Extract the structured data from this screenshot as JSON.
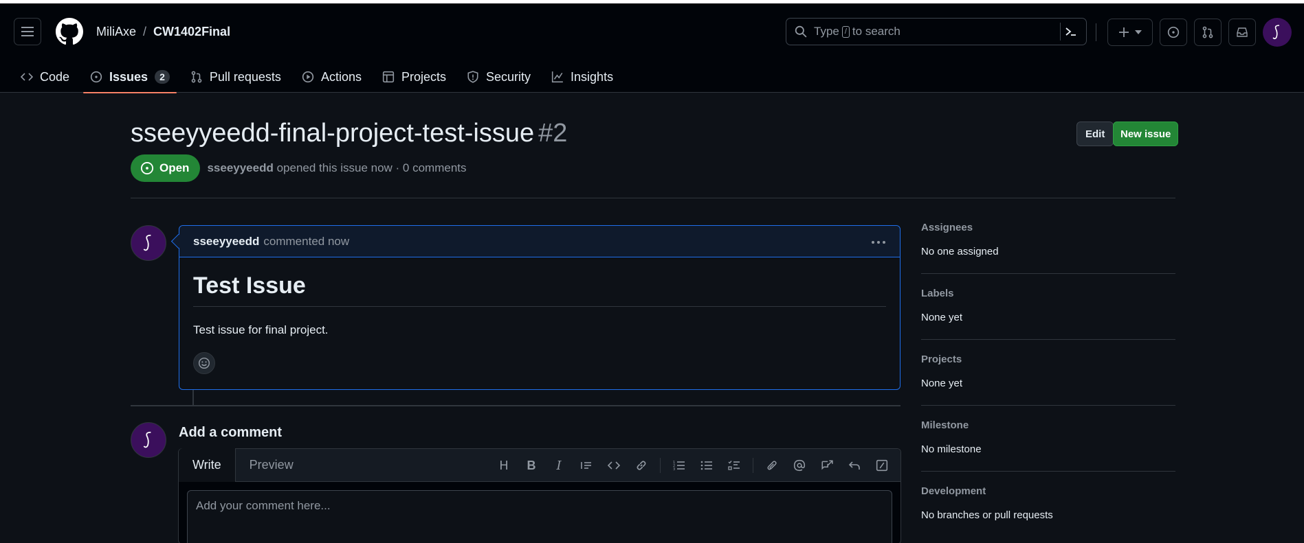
{
  "header": {
    "owner": "MiliAxe",
    "separator": "/",
    "repo": "CW1402Final",
    "search_prefix": "Type",
    "search_key": "/",
    "search_suffix": "to search"
  },
  "tabs": [
    {
      "label": "Code"
    },
    {
      "label": "Issues",
      "count": "2"
    },
    {
      "label": "Pull requests"
    },
    {
      "label": "Actions"
    },
    {
      "label": "Projects"
    },
    {
      "label": "Security"
    },
    {
      "label": "Insights"
    }
  ],
  "issue": {
    "title": "sseeyyeedd-final-project-test-issue",
    "number": "#2",
    "edit_label": "Edit",
    "new_issue_label": "New issue",
    "state": "Open",
    "author": "sseeyyeedd",
    "meta_text": "opened this issue now · 0 comments"
  },
  "comment": {
    "author": "sseeyyeedd",
    "action": "commented now",
    "heading": "Test Issue",
    "body": "Test issue for final project."
  },
  "composer": {
    "title": "Add a comment",
    "write_tab": "Write",
    "preview_tab": "Preview",
    "placeholder": "Add your comment here..."
  },
  "sidebar": [
    {
      "heading": "Assignees",
      "value": "No one assigned"
    },
    {
      "heading": "Labels",
      "value": "None yet"
    },
    {
      "heading": "Projects",
      "value": "None yet"
    },
    {
      "heading": "Milestone",
      "value": "No milestone"
    },
    {
      "heading": "Development",
      "value": "No branches or pull requests"
    }
  ],
  "colors": {
    "accent_open": "#238636",
    "tab_underline": "#f78166",
    "focus_border": "#1f6feb",
    "avatar_bg": "#3b0f5c"
  }
}
